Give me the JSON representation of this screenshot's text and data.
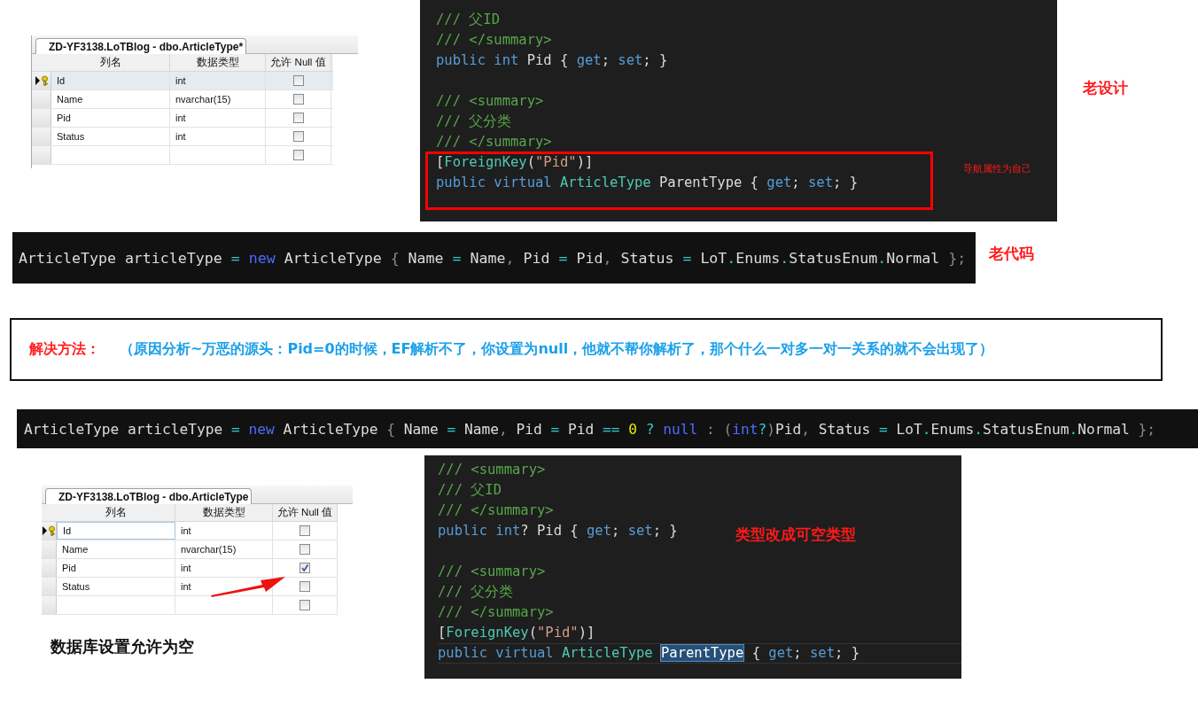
{
  "old_table": {
    "tab_title": "ZD-YF3138.LoTBlog - dbo.ArticleType*",
    "columns": [
      "列名",
      "数据类型",
      "允许 Null 值"
    ],
    "rows": [
      {
        "name": "Id",
        "type": "int",
        "allow_null": false,
        "selected": true,
        "current": true,
        "primary_key": true,
        "editing": false
      },
      {
        "name": "Name",
        "type": "nvarchar(15)",
        "allow_null": false,
        "selected": false,
        "current": false,
        "primary_key": false,
        "editing": false
      },
      {
        "name": "Pid",
        "type": "int",
        "allow_null": false,
        "selected": false,
        "current": false,
        "primary_key": false,
        "editing": false
      },
      {
        "name": "Status",
        "type": "int",
        "allow_null": false,
        "selected": false,
        "current": false,
        "primary_key": false,
        "editing": false
      },
      {
        "allow_null": false,
        "selected": false,
        "current": false,
        "primary_key": false,
        "editing": false
      }
    ]
  },
  "old_code": {
    "lines": [
      {
        "kind": "code",
        "tokens": [
          {
            "kind": "comment",
            "text": "/// 父ID"
          }
        ]
      },
      {
        "kind": "code",
        "tokens": [
          {
            "kind": "comment",
            "text": "/// </summary>"
          }
        ]
      },
      {
        "kind": "code",
        "tokens": [
          {
            "kind": "keyword",
            "text": "public int"
          },
          {
            "kind": "plain",
            "text": " Pid { "
          },
          {
            "kind": "keyword",
            "text": "get"
          },
          {
            "kind": "plain",
            "text": "; "
          },
          {
            "kind": "keyword",
            "text": "set"
          },
          {
            "kind": "plain",
            "text": "; }"
          }
        ]
      },
      {
        "kind": "blank"
      },
      {
        "kind": "code",
        "tokens": [
          {
            "kind": "comment",
            "text": "/// <summary>"
          }
        ]
      },
      {
        "kind": "code",
        "tokens": [
          {
            "kind": "comment",
            "text": "/// 父分类"
          }
        ]
      },
      {
        "kind": "code",
        "tokens": [
          {
            "kind": "comment",
            "text": "/// </summary>"
          }
        ]
      },
      {
        "kind": "code",
        "tokens": [
          {
            "kind": "plain",
            "text": "["
          },
          {
            "kind": "type",
            "text": "ForeignKey"
          },
          {
            "kind": "plain",
            "text": "("
          },
          {
            "kind": "string",
            "text": "\"Pid\""
          },
          {
            "kind": "plain",
            "text": ")]"
          }
        ]
      },
      {
        "kind": "code",
        "tokens": [
          {
            "kind": "keyword",
            "text": "public virtual "
          },
          {
            "kind": "type",
            "text": "ArticleType"
          },
          {
            "kind": "plain",
            "text": " ParentType { "
          },
          {
            "kind": "keyword",
            "text": "get"
          },
          {
            "kind": "plain",
            "text": "; "
          },
          {
            "kind": "keyword",
            "text": "set"
          },
          {
            "kind": "plain",
            "text": "; }"
          }
        ]
      }
    ]
  },
  "old_design_label": "老设计",
  "navigation_note": "导航属性为自己",
  "old_snippet": {
    "tokens": [
      {
        "kind": "plain",
        "text": "ArticleType articleType "
      },
      {
        "kind": "op",
        "text": "= "
      },
      {
        "kind": "new",
        "text": "new"
      },
      {
        "kind": "plain",
        "text": " ArticleType "
      },
      {
        "kind": "punct",
        "text": "{"
      },
      {
        "kind": "plain",
        "text": " Name "
      },
      {
        "kind": "op",
        "text": "="
      },
      {
        "kind": "plain",
        "text": " Name"
      },
      {
        "kind": "punct",
        "text": ","
      },
      {
        "kind": "plain",
        "text": " Pid "
      },
      {
        "kind": "op",
        "text": "="
      },
      {
        "kind": "plain",
        "text": " Pid"
      },
      {
        "kind": "punct",
        "text": ","
      },
      {
        "kind": "plain",
        "text": " Status "
      },
      {
        "kind": "op",
        "text": "="
      },
      {
        "kind": "plain",
        "text": " LoT"
      },
      {
        "kind": "op",
        "text": "."
      },
      {
        "kind": "plain",
        "text": "Enums"
      },
      {
        "kind": "op",
        "text": "."
      },
      {
        "kind": "plain",
        "text": "StatusEnum"
      },
      {
        "kind": "op",
        "text": "."
      },
      {
        "kind": "plain",
        "text": "Normal "
      },
      {
        "kind": "punct",
        "text": "};"
      }
    ]
  },
  "old_code_label": "老代码",
  "solution": {
    "label": "解决方法：",
    "text": "（原因分析~万恶的源头：Pid=0的时候，EF解析不了，你设置为null，他就不帮你解析了，那个什么一对多一对一关系的就不会出现了）"
  },
  "new_snippet": {
    "tokens": [
      {
        "kind": "plain",
        "text": "ArticleType articleType "
      },
      {
        "kind": "op",
        "text": "= "
      },
      {
        "kind": "new",
        "text": "new"
      },
      {
        "kind": "plain",
        "text": " ArticleType "
      },
      {
        "kind": "punct",
        "text": "{"
      },
      {
        "kind": "plain",
        "text": " Name "
      },
      {
        "kind": "op",
        "text": "="
      },
      {
        "kind": "plain",
        "text": " Name"
      },
      {
        "kind": "punct",
        "text": ","
      },
      {
        "kind": "plain",
        "text": " Pid "
      },
      {
        "kind": "op",
        "text": "="
      },
      {
        "kind": "plain",
        "text": " Pid "
      },
      {
        "kind": "op",
        "text": "== "
      },
      {
        "kind": "number",
        "text": "0 "
      },
      {
        "kind": "op",
        "text": "? "
      },
      {
        "kind": "new",
        "text": "null "
      },
      {
        "kind": "punct",
        "text": ": ("
      },
      {
        "kind": "new",
        "text": "int"
      },
      {
        "kind": "op",
        "text": "?"
      },
      {
        "kind": "punct",
        "text": ")"
      },
      {
        "kind": "plain",
        "text": "Pid"
      },
      {
        "kind": "punct",
        "text": ","
      },
      {
        "kind": "plain",
        "text": " Status "
      },
      {
        "kind": "op",
        "text": "="
      },
      {
        "kind": "plain",
        "text": " LoT"
      },
      {
        "kind": "op",
        "text": "."
      },
      {
        "kind": "plain",
        "text": "Enums"
      },
      {
        "kind": "op",
        "text": "."
      },
      {
        "kind": "plain",
        "text": "StatusEnum"
      },
      {
        "kind": "op",
        "text": "."
      },
      {
        "kind": "plain",
        "text": "Normal "
      },
      {
        "kind": "punct",
        "text": "};"
      }
    ]
  },
  "new_table": {
    "tab_title": "ZD-YF3138.LoTBlog - dbo.ArticleType",
    "columns": [
      "列名",
      "数据类型",
      "允许 Null 值"
    ],
    "rows": [
      {
        "name": "Id",
        "type": "int",
        "allow_null": false,
        "selected": false,
        "current": true,
        "primary_key": true,
        "editing": true
      },
      {
        "name": "Name",
        "type": "nvarchar(15)",
        "allow_null": false,
        "selected": false,
        "current": false,
        "primary_key": false,
        "editing": false
      },
      {
        "name": "Pid",
        "type": "int",
        "allow_null": true,
        "selected": false,
        "current": false,
        "primary_key": false,
        "editing": false
      },
      {
        "name": "Status",
        "type": "int",
        "allow_null": false,
        "selected": false,
        "current": false,
        "primary_key": false,
        "editing": false
      },
      {
        "allow_null": false,
        "selected": false,
        "current": false,
        "primary_key": false,
        "editing": false
      }
    ]
  },
  "new_table_caption": "数据库设置允许为空",
  "new_code": {
    "lines": [
      {
        "kind": "code",
        "tokens": [
          {
            "kind": "comment",
            "text": "/// <summary>"
          }
        ]
      },
      {
        "kind": "code",
        "tokens": [
          {
            "kind": "comment",
            "text": "/// 父ID"
          }
        ]
      },
      {
        "kind": "code",
        "tokens": [
          {
            "kind": "comment",
            "text": "/// </summary>"
          }
        ]
      },
      {
        "kind": "code",
        "tokens": [
          {
            "kind": "keyword",
            "text": "public int"
          },
          {
            "kind": "plain",
            "text": "? Pid { "
          },
          {
            "kind": "keyword",
            "text": "get"
          },
          {
            "kind": "plain",
            "text": "; "
          },
          {
            "kind": "keyword",
            "text": "set"
          },
          {
            "kind": "plain",
            "text": "; }"
          }
        ]
      },
      {
        "kind": "blank"
      },
      {
        "kind": "code",
        "tokens": [
          {
            "kind": "comment",
            "text": "/// <summary>"
          }
        ]
      },
      {
        "kind": "code",
        "tokens": [
          {
            "kind": "comment",
            "text": "/// 父分类"
          }
        ]
      },
      {
        "kind": "code",
        "tokens": [
          {
            "kind": "comment",
            "text": "/// </summary>"
          }
        ]
      },
      {
        "kind": "code",
        "tokens": [
          {
            "kind": "plain",
            "text": "["
          },
          {
            "kind": "type",
            "text": "ForeignKey"
          },
          {
            "kind": "plain",
            "text": "("
          },
          {
            "kind": "string",
            "text": "\"Pid\""
          },
          {
            "kind": "plain",
            "text": ")]"
          }
        ]
      },
      {
        "kind": "code",
        "current": true,
        "tokens": [
          {
            "kind": "keyword",
            "text": "public virtual "
          },
          {
            "kind": "type",
            "text": "ArticleType "
          },
          {
            "kind": "selection",
            "text": "ParentType"
          },
          {
            "kind": "plain",
            "text": " { "
          },
          {
            "kind": "keyword",
            "text": "get"
          },
          {
            "kind": "plain",
            "text": "; "
          },
          {
            "kind": "keyword",
            "text": "set"
          },
          {
            "kind": "plain",
            "text": "; }"
          }
        ]
      }
    ]
  },
  "nullable_label": "类型改成可空类型"
}
